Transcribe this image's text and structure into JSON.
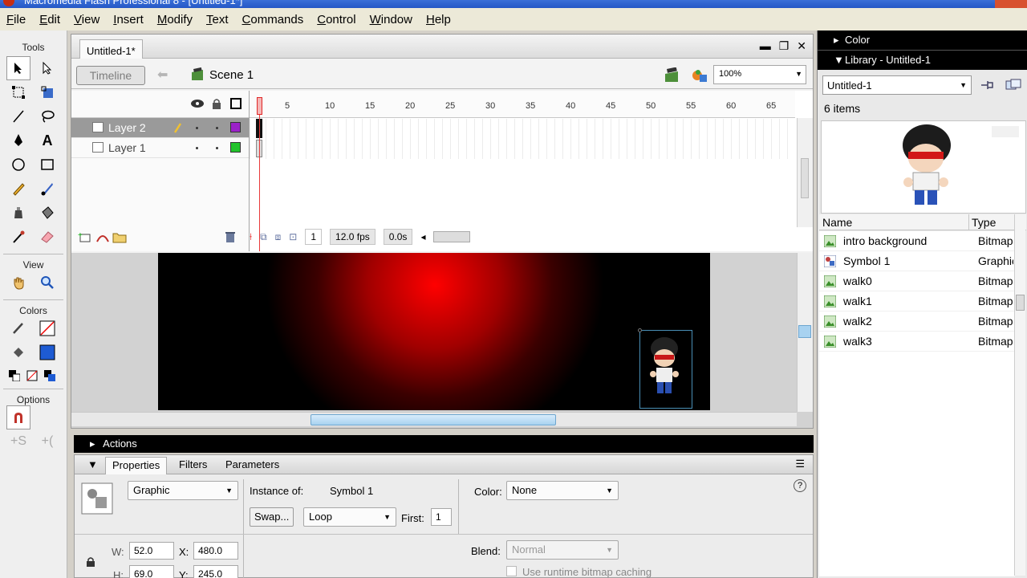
{
  "window": {
    "title": "Macromedia Flash Professional 8 - [Untitled-1*]"
  },
  "menu": [
    "File",
    "Edit",
    "View",
    "Insert",
    "Modify",
    "Text",
    "Commands",
    "Control",
    "Window",
    "Help"
  ],
  "tools": {
    "heading": "Tools",
    "view_heading": "View",
    "colors_heading": "Colors",
    "options_heading": "Options"
  },
  "document": {
    "tab": "Untitled-1*",
    "timeline_button": "Timeline",
    "scene": "Scene 1",
    "zoom": "100%"
  },
  "timeline": {
    "layers": [
      {
        "name": "Layer 2",
        "selected": true,
        "color": "#9b22c8"
      },
      {
        "name": "Layer 1",
        "selected": false,
        "color": "#22c32b"
      }
    ],
    "ruler": [
      "5",
      "10",
      "15",
      "20",
      "25",
      "30",
      "35",
      "40",
      "45",
      "50",
      "55",
      "60",
      "65"
    ],
    "current_frame": "1",
    "frame_rate": "12.0 fps",
    "elapsed": "0.0s"
  },
  "actions_panel": {
    "title": "Actions"
  },
  "properties": {
    "tabs": [
      "Properties",
      "Filters",
      "Parameters"
    ],
    "symbol_behavior": "Graphic",
    "instance_of_label": "Instance of:",
    "instance_of_value": "Symbol 1",
    "swap_label": "Swap...",
    "loop_value": "Loop",
    "first_label": "First:",
    "first_value": "1",
    "color_label": "Color:",
    "color_value": "None",
    "w_label": "W:",
    "w_value": "52.0",
    "h_label": "H:",
    "h_value": "69.0",
    "x_label": "X:",
    "x_value": "480.0",
    "y_label": "Y:",
    "y_value": "245.0",
    "blend_label": "Blend:",
    "blend_value": "Normal",
    "cache_label": "Use runtime bitmap caching"
  },
  "right_panel": {
    "color_title": "Color",
    "library_title": "Library - Untitled-1",
    "library_doc": "Untitled-1",
    "item_count": "6 items",
    "col_name": "Name",
    "col_type": "Type",
    "items": [
      {
        "name": "intro background",
        "type": "Bitmap",
        "icon": "bitmap-icon"
      },
      {
        "name": "Symbol 1",
        "type": "Graphic",
        "icon": "graphic-symbol-icon"
      },
      {
        "name": "walk0",
        "type": "Bitmap",
        "icon": "bitmap-icon"
      },
      {
        "name": "walk1",
        "type": "Bitmap",
        "icon": "bitmap-icon"
      },
      {
        "name": "walk2",
        "type": "Bitmap",
        "icon": "bitmap-icon"
      },
      {
        "name": "walk3",
        "type": "Bitmap",
        "icon": "bitmap-icon"
      }
    ]
  }
}
